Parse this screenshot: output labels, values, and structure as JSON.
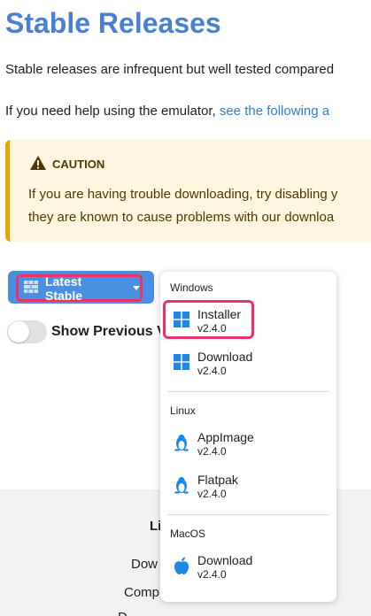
{
  "page": {
    "title": "Stable Releases",
    "para1": "Stable releases are infrequent but well tested compared",
    "para2_prefix": "If you need help using the emulator, ",
    "para2_link": "see the following a"
  },
  "caution": {
    "heading": "CAUTION",
    "line1": "If you are having trouble downloading, try disabling y",
    "line2": "they are known to cause problems with our downloa"
  },
  "controls": {
    "latest_button": "Latest Stable",
    "toggle_label": "Show Previous V",
    "toggle_on": false
  },
  "dropdown": {
    "sections": [
      {
        "name": "Windows",
        "items": [
          {
            "label": "Installer",
            "version": "v2.4.0",
            "icon": "windows-icon"
          },
          {
            "label": "Download",
            "version": "v2.4.0",
            "icon": "windows-icon"
          }
        ]
      },
      {
        "name": "Linux",
        "items": [
          {
            "label": "AppImage",
            "version": "v2.4.0",
            "icon": "linux-icon"
          },
          {
            "label": "Flatpak",
            "version": "v2.4.0",
            "icon": "linux-icon"
          }
        ]
      },
      {
        "name": "MacOS",
        "items": [
          {
            "label": "Download",
            "version": "v2.4.0",
            "icon": "apple-icon"
          }
        ]
      }
    ]
  },
  "footer": {
    "title": "Li",
    "link1": "Dow",
    "link2": "Comp",
    "link3": "D"
  },
  "colors": {
    "title": "#4a7fd1",
    "link": "#2f7bd9",
    "button": "#4a90e2",
    "highlight": "#e8336d",
    "caution_bg": "#fff6e0",
    "caution_border": "#e6a700"
  }
}
